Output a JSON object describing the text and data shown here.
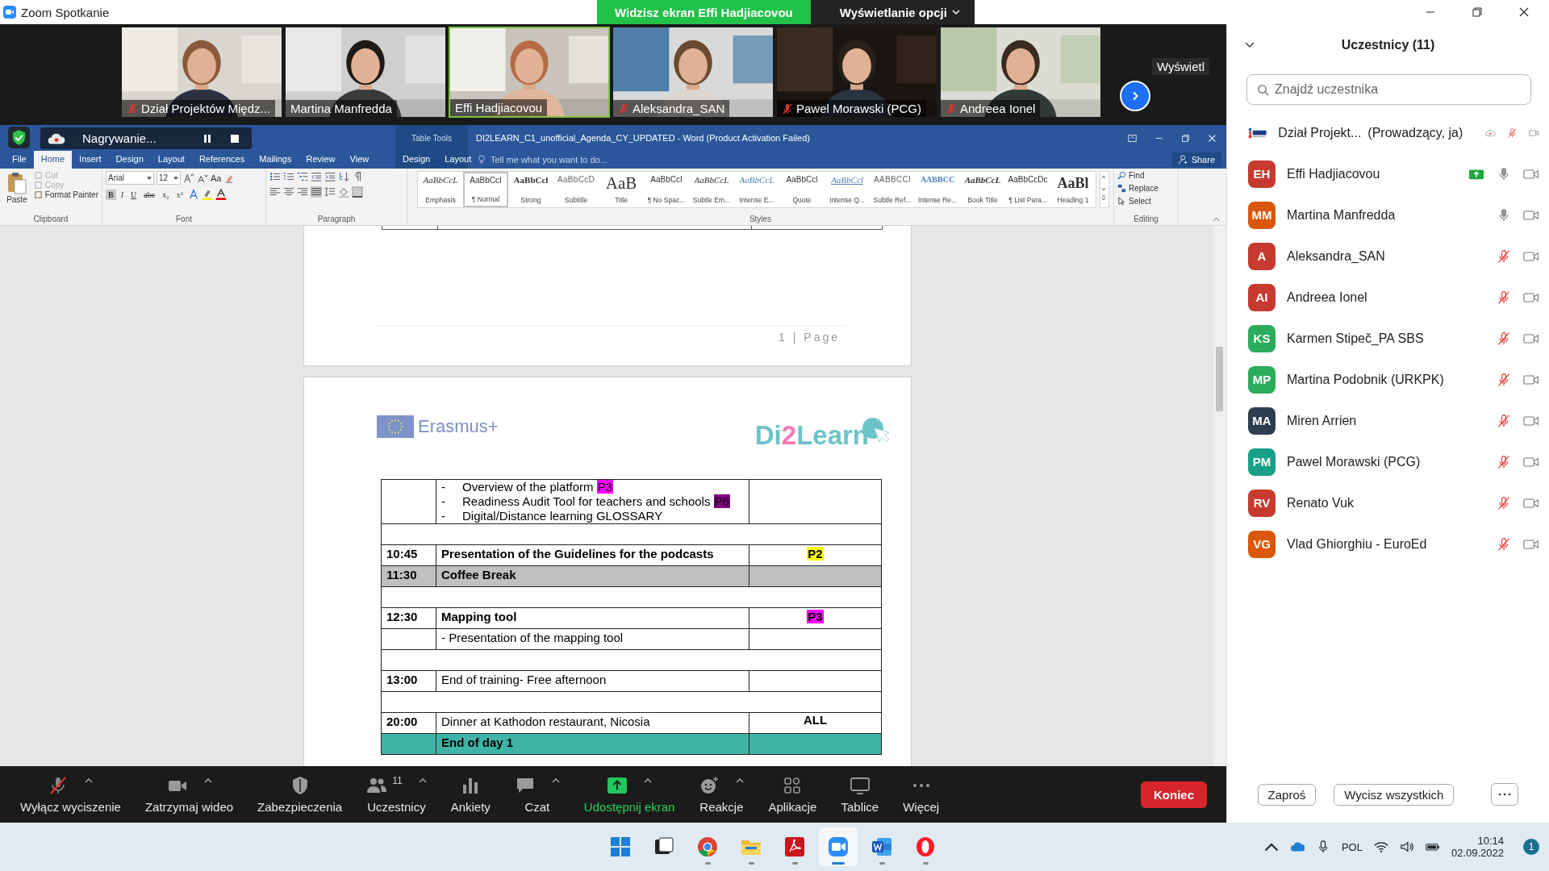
{
  "title_bar": {
    "app_title": "Zoom Spotkanie",
    "share_banner": "Widzisz ekran Effi Hadjiacovou",
    "view_options": "Wyświetlanie opcji"
  },
  "video_strip": {
    "tiles": [
      {
        "name": "Dział Projektów Międz...",
        "muted": true,
        "speaking": false
      },
      {
        "name": "Martina Manfredda",
        "muted": false,
        "speaking": false
      },
      {
        "name": "Effi Hadjiacovou",
        "muted": false,
        "speaking": true
      },
      {
        "name": "Aleksandra_SAN",
        "muted": true,
        "speaking": false
      },
      {
        "name": "Pawel Morawski (PCG)",
        "muted": true,
        "speaking": false
      },
      {
        "name": "Andreea Ionel",
        "muted": true,
        "speaking": false
      }
    ],
    "view_label": "Wyświetl"
  },
  "word": {
    "recording": {
      "label": "Nagrywanie..."
    },
    "contextual_label": "Table Tools",
    "document_title": "DI2LEARN_C1_unofficial_Agenda_CY_UPDATED - Word (Product Activation Failed)",
    "tabs": [
      {
        "label": "File",
        "selected": false
      },
      {
        "label": "Home",
        "selected": true
      },
      {
        "label": "Insert",
        "selected": false
      },
      {
        "label": "Design",
        "selected": false
      },
      {
        "label": "Layout",
        "selected": false
      },
      {
        "label": "References",
        "selected": false
      },
      {
        "label": "Mailings",
        "selected": false
      },
      {
        "label": "Review",
        "selected": false
      },
      {
        "label": "View",
        "selected": false
      }
    ],
    "contextual_tabs": [
      {
        "label": "Design",
        "selected": false
      },
      {
        "label": "Layout",
        "selected": false
      }
    ],
    "tell_me": {
      "placeholder": "Tell me what you want to do..."
    },
    "share": "Share",
    "ribbon": {
      "clipboard": {
        "label": "Clipboard",
        "paste": "Paste",
        "items": [
          {
            "label": "Cut",
            "disabled": true
          },
          {
            "label": "Copy",
            "disabled": true
          },
          {
            "label": "Format Painter",
            "disabled": false
          }
        ]
      },
      "font": {
        "label": "Font",
        "family": "Arial",
        "size": "12",
        "change_case": "Aa",
        "format_buttons": [
          {
            "label": "B",
            "on": true,
            "kind": "bold"
          },
          {
            "label": "I",
            "on": false,
            "kind": "italic"
          },
          {
            "label": "U",
            "on": false,
            "kind": "underline"
          },
          {
            "label": "abc",
            "on": false,
            "kind": "strike"
          },
          {
            "label": "x₂",
            "on": false,
            "kind": "plain"
          },
          {
            "label": "x²",
            "on": false,
            "kind": "plain"
          }
        ]
      },
      "paragraph": {
        "label": "Paragraph"
      },
      "styles": {
        "label": "Styles",
        "items": [
          {
            "preview": "AaBbCcL",
            "name": "Emphasis",
            "kind": "italic",
            "selected": false
          },
          {
            "preview": "AaBbCcI",
            "name": "¶ Normal",
            "kind": "plain",
            "selected": true
          },
          {
            "preview": "AaBbCcl",
            "name": "Strong",
            "kind": "bold",
            "selected": false
          },
          {
            "preview": "AaBbCcD",
            "name": "Subtitle",
            "kind": "spaced",
            "selected": false
          },
          {
            "preview": "AaB",
            "name": "Title",
            "kind": "title",
            "selected": false
          },
          {
            "preview": "AaBbCcI",
            "name": "¶ No Spac...",
            "kind": "plain",
            "selected": false
          },
          {
            "preview": "AaBbCcL",
            "name": "Subtle Em...",
            "kind": "italic",
            "selected": false
          },
          {
            "preview": "AaBbCcL",
            "name": "Intense E...",
            "kind": "blue-italic",
            "selected": false
          },
          {
            "preview": "AaBbCcl",
            "name": "Quote",
            "kind": "plain",
            "selected": false
          },
          {
            "preview": "AaBbCcl",
            "name": "Intense Q...",
            "kind": "underlined",
            "selected": false
          },
          {
            "preview": "AABBCCI",
            "name": "Subtle Ref...",
            "kind": "spaced",
            "selected": false
          },
          {
            "preview": "AABBCC",
            "name": "Intense Re...",
            "kind": "blue-bold",
            "selected": false
          },
          {
            "preview": "AaBbCcL",
            "name": "Book Title",
            "kind": "bold-italic",
            "selected": false
          },
          {
            "preview": "AaBbCcDc",
            "name": "¶ List Para...",
            "kind": "plain",
            "selected": false
          },
          {
            "preview": "AaBl",
            "name": "Heading 1",
            "kind": "heading",
            "selected": false
          }
        ]
      },
      "editing": {
        "label": "Editing",
        "items": [
          {
            "label": "Find",
            "kind": "find"
          },
          {
            "label": "Replace",
            "kind": "replace"
          },
          {
            "label": "Select",
            "kind": "select"
          }
        ]
      }
    },
    "document": {
      "page_footer": "1 | Page",
      "logo_left": "Erasmus+",
      "logo_right": [
        {
          "text": "Di",
          "color": "#6cc4c9"
        },
        {
          "text": "2",
          "color": "#f07ab6"
        },
        {
          "text": "Learn",
          "color": "#6cc4c9"
        }
      ],
      "agenda_rows": [
        {
          "kind": "list",
          "bullets": [
            {
              "marker": "-",
              "text": "Overview of the platform",
              "tag": {
                "text": "P3",
                "color": "#ff00ff"
              }
            },
            {
              "marker": "-",
              "text": "Readiness Audit Tool for teachers and schools",
              "tag": {
                "text": "P6",
                "color": "#800080"
              }
            },
            {
              "marker": "-",
              "text": "Digital/Distance learning GLOSSARY"
            }
          ]
        },
        {
          "kind": "blank"
        },
        {
          "kind": "item",
          "time": "10:45",
          "activity": "Presentation of the Guidelines for the podcasts",
          "bold": true,
          "tag": {
            "text": "P2",
            "color": "#ffff00"
          }
        },
        {
          "kind": "item",
          "time": "11:30",
          "activity": "Coffee Break",
          "bold": true,
          "color": "#c0bfc2"
        },
        {
          "kind": "blank"
        },
        {
          "kind": "item",
          "time": "12:30",
          "activity": "Mapping tool",
          "bold": true,
          "tag": {
            "text": "P3",
            "color": "#ff00ff"
          }
        },
        {
          "kind": "item",
          "activity": "- Presentation of the mapping tool",
          "bold": false
        },
        {
          "kind": "blank"
        },
        {
          "kind": "item",
          "time": "13:00",
          "activity": "End of training- Free afternoon",
          "bold": false
        },
        {
          "kind": "blank"
        },
        {
          "kind": "item",
          "time": "20:00",
          "activity": "Dinner at Kathodon restaurant, Nicosia",
          "bold": false,
          "who": "ALL"
        },
        {
          "kind": "item",
          "activity": "End of day 1",
          "bold": true,
          "color": "#40b3a8"
        }
      ]
    }
  },
  "toolbar": {
    "items": [
      {
        "label": "Wyłącz wyciszenie",
        "kind": "mic-muted",
        "caret": true
      },
      {
        "label": "Zatrzymaj wideo",
        "kind": "video",
        "caret": true
      },
      {
        "label": "Zabezpieczenia",
        "kind": "shield",
        "caret": false
      },
      {
        "label": "Uczestnicy",
        "kind": "people",
        "caret": true,
        "count": "11"
      },
      {
        "label": "Ankiety",
        "kind": "polls",
        "caret": false
      },
      {
        "label": "Czat",
        "kind": "chat",
        "caret": true
      },
      {
        "label": "Udostępnij ekran",
        "kind": "share",
        "caret": true
      },
      {
        "label": "Reakcje",
        "kind": "reactions",
        "caret": true
      },
      {
        "label": "Aplikacje",
        "kind": "apps",
        "caret": false
      },
      {
        "label": "Tablice",
        "kind": "whiteboard",
        "caret": false
      },
      {
        "label": "Więcej",
        "kind": "more",
        "caret": false
      }
    ],
    "end_button": "Koniec"
  },
  "participants": {
    "title": "Uczestnicy (11)",
    "search": {
      "placeholder": "Znajdź uczestnika"
    },
    "people": [
      {
        "kind": "logo",
        "name": "Dział Projekt...",
        "role": "(Prowadzący, ja)",
        "recording": true,
        "sharing": false,
        "muted": true
      },
      {
        "kind": "initials",
        "initials": "EH",
        "color": "#c63a2f",
        "name": "Effi Hadjiacovou",
        "recording": false,
        "sharing": true,
        "muted": false
      },
      {
        "kind": "initials",
        "initials": "MM",
        "color": "#d9580b",
        "name": "Martina Manfredda",
        "recording": false,
        "sharing": false,
        "muted": false
      },
      {
        "kind": "initials",
        "initials": "A",
        "color": "#c63a2f",
        "name": "Aleksandra_SAN",
        "recording": false,
        "sharing": false,
        "muted": true
      },
      {
        "kind": "initials",
        "initials": "AI",
        "color": "#c63a2f",
        "name": "Andreea Ionel",
        "recording": false,
        "sharing": false,
        "muted": true
      },
      {
        "kind": "initials",
        "initials": "KS",
        "color": "#2bab5c",
        "name": "Karmen Stipeč_PA SBS",
        "recording": false,
        "sharing": false,
        "muted": true
      },
      {
        "kind": "initials",
        "initials": "MP",
        "color": "#2bab5c",
        "name": "Martina Podobnik (URKPK)",
        "recording": false,
        "sharing": false,
        "muted": true
      },
      {
        "kind": "initials",
        "initials": "MA",
        "color": "#2d3e50",
        "name": "Miren Arrien",
        "recording": false,
        "sharing": false,
        "muted": true
      },
      {
        "kind": "initials",
        "initials": "PM",
        "color": "#17a086",
        "name": "Pawel Morawski (PCG)",
        "recording": false,
        "sharing": false,
        "muted": true
      },
      {
        "kind": "initials",
        "initials": "RV",
        "color": "#c63a2f",
        "name": "Renato Vuk",
        "recording": false,
        "sharing": false,
        "muted": true
      },
      {
        "kind": "initials",
        "initials": "VG",
        "color": "#d9580b",
        "name": "Vlad Ghiorghiu - EuroEd",
        "recording": false,
        "sharing": false,
        "muted": true
      }
    ],
    "buttons": [
      "Zaproś",
      "Wycisz wszystkich"
    ]
  },
  "taskbar": {
    "apps": [
      {
        "kind": "windows",
        "running": false,
        "active": false
      },
      {
        "kind": "taskview",
        "running": false,
        "active": false
      },
      {
        "kind": "chrome",
        "running": true,
        "active": false
      },
      {
        "kind": "folder",
        "running": true,
        "active": false
      },
      {
        "kind": "acrobat",
        "running": true,
        "active": false
      },
      {
        "kind": "zoom",
        "running": true,
        "active": true
      },
      {
        "kind": "word",
        "running": true,
        "active": false
      },
      {
        "kind": "opera",
        "running": true,
        "active": false
      }
    ],
    "language": "POL",
    "time": "10:14",
    "date": "02.09.2022",
    "notifications": "1"
  }
}
